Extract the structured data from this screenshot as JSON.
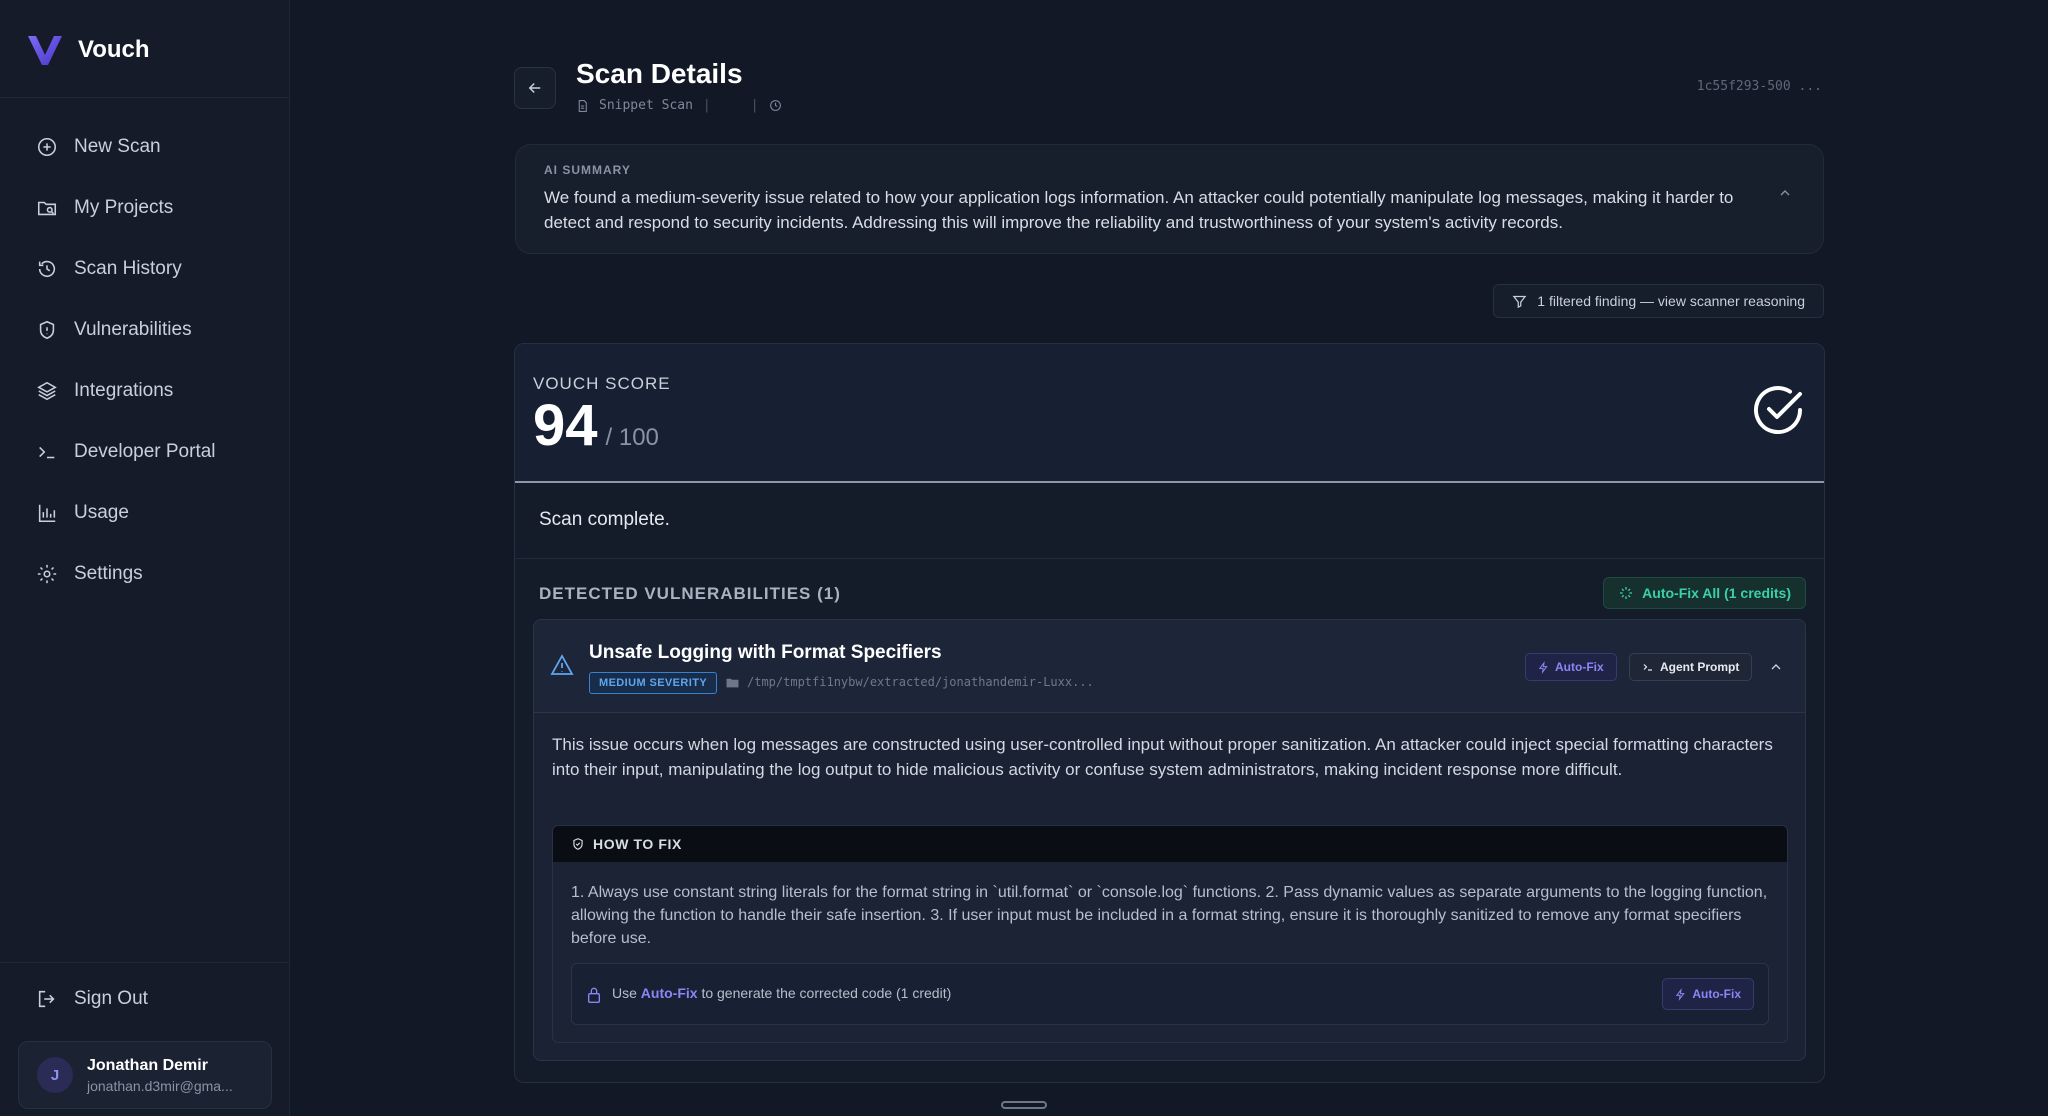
{
  "brand": {
    "name": "Vouch"
  },
  "sidebar": {
    "items": [
      {
        "label": "New Scan",
        "icon": "plus-circle-icon"
      },
      {
        "label": "My Projects",
        "icon": "folder-search-icon"
      },
      {
        "label": "Scan History",
        "icon": "history-icon"
      },
      {
        "label": "Vulnerabilities",
        "icon": "shield-icon"
      },
      {
        "label": "Integrations",
        "icon": "layers-icon"
      },
      {
        "label": "Developer Portal",
        "icon": "terminal-icon"
      },
      {
        "label": "Usage",
        "icon": "bar-chart-icon"
      },
      {
        "label": "Settings",
        "icon": "gear-icon"
      }
    ],
    "sign_out": "Sign Out",
    "user": {
      "initial": "J",
      "name": "Jonathan Demir",
      "email": "jonathan.d3mir@gma..."
    }
  },
  "header": {
    "title": "Scan Details",
    "subtitle": "Snippet Scan",
    "scan_id": "1c55f293-500 ..."
  },
  "ai_summary": {
    "label": "AI SUMMARY",
    "text": "We found a medium-severity issue related to how your application logs information. An attacker could potentially manipulate log messages, making it harder to detect and respond to security incidents. Addressing this will improve the reliability and trustworthiness of your system's activity records."
  },
  "filter_chip": "1 filtered finding — view scanner reasoning",
  "score": {
    "label": "VOUCH SCORE",
    "value": "94",
    "max": "/ 100",
    "status": "Scan complete."
  },
  "detected": {
    "label": "DETECTED VULNERABILITIES (1)",
    "autofix_all": "Auto-Fix All (1 credits)"
  },
  "vulnerability": {
    "title": "Unsafe Logging with Format Specifiers",
    "severity": "MEDIUM SEVERITY",
    "path": "/tmp/tmptfi1nybw/extracted/jonathandemir-Luxx...",
    "autofix_label": "Auto-Fix",
    "agent_prompt_label": "Agent Prompt",
    "description": "This issue occurs when log messages are constructed using user-controlled input without proper sanitization. An attacker could inject special formatting characters into their input, manipulating the log output to hide malicious activity or confuse system administrators, making incident response more difficult.",
    "how_to_fix": {
      "label": "HOW TO FIX",
      "text": "1. Always use constant string literals for the format string in `util.format` or `console.log` functions. 2. Pass dynamic values as separate arguments to the logging function, allowing the function to handle their safe insertion. 3. If user input must be included in a format string, ensure it is thoroughly sanitized to remove any format specifiers before use.",
      "lock_prefix": "Use",
      "lock_link": "Auto-Fix",
      "lock_suffix": "to generate the corrected code (1 credit)",
      "lock_button": "Auto-Fix"
    }
  },
  "colors": {
    "accent": "#8a86f5",
    "success": "#3bd1a8",
    "severity_medium": "#5fa5f0"
  }
}
